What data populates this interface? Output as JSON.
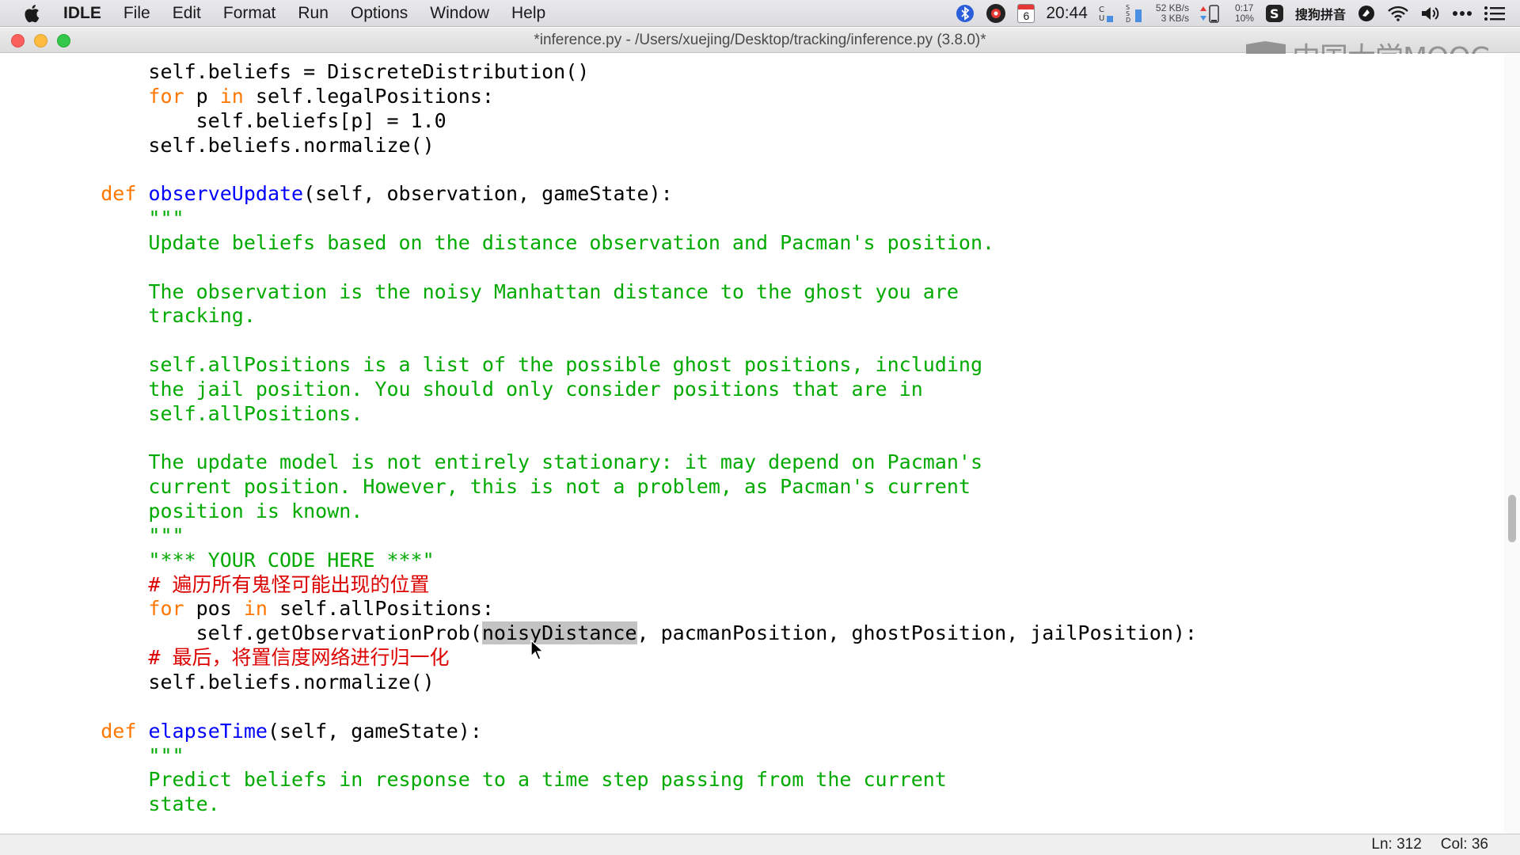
{
  "menubar": {
    "apple_icon": "apple-logo-icon",
    "app_name": "IDLE",
    "items": [
      "File",
      "Edit",
      "Format",
      "Run",
      "Options",
      "Window",
      "Help"
    ],
    "status": {
      "bluetooth_icon": "bluetooth-icon",
      "calendar_day": "6",
      "clock": "20:44",
      "cpu_label": "C\nU",
      "ssd_label": "S\nS\nD",
      "net_up": "52 KB/s",
      "net_down": "3 KB/s",
      "battery_time": "0:17",
      "battery_pct": "10%",
      "ime_label": "搜狗拼音",
      "wifi_icon": "wifi-icon",
      "volume_icon": "volume-icon",
      "more_icon": "more-icon",
      "list_icon": "control-center-icon"
    }
  },
  "window": {
    "title": "*inference.py - /Users/xuejing/Desktop/tracking/inference.py (3.8.0)*",
    "watermark_text": "中国大学MOOC",
    "statusbar": {
      "line": "Ln: 312",
      "col": "Col: 36"
    }
  },
  "code": {
    "lines": [
      {
        "indent": "        ",
        "parts": [
          [
            "",
            "self.beliefs = DiscreteDistribution()"
          ]
        ]
      },
      {
        "indent": "        ",
        "parts": [
          [
            "kw",
            "for"
          ],
          [
            "",
            " p "
          ],
          [
            "kw",
            "in"
          ],
          [
            "",
            " self.legalPositions:"
          ]
        ]
      },
      {
        "indent": "            ",
        "parts": [
          [
            "",
            "self.beliefs[p] = 1.0"
          ]
        ]
      },
      {
        "indent": "        ",
        "parts": [
          [
            "",
            "self.beliefs.normalize()"
          ]
        ]
      },
      {
        "indent": "",
        "parts": []
      },
      {
        "indent": "    ",
        "parts": [
          [
            "kw",
            "def"
          ],
          [
            "",
            " "
          ],
          [
            "fn",
            "observeUpdate"
          ],
          [
            "",
            "(self, observation, gameState):"
          ]
        ]
      },
      {
        "indent": "        ",
        "parts": [
          [
            "str",
            "\"\"\""
          ]
        ]
      },
      {
        "indent": "        ",
        "parts": [
          [
            "str",
            "Update beliefs based on the distance observation and Pacman's position."
          ]
        ]
      },
      {
        "indent": "",
        "parts": []
      },
      {
        "indent": "        ",
        "parts": [
          [
            "str",
            "The observation is the noisy Manhattan distance to the ghost you are"
          ]
        ]
      },
      {
        "indent": "        ",
        "parts": [
          [
            "str",
            "tracking."
          ]
        ]
      },
      {
        "indent": "",
        "parts": []
      },
      {
        "indent": "        ",
        "parts": [
          [
            "str",
            "self.allPositions is a list of the possible ghost positions, including"
          ]
        ]
      },
      {
        "indent": "        ",
        "parts": [
          [
            "str",
            "the jail position. You should only consider positions that are in"
          ]
        ]
      },
      {
        "indent": "        ",
        "parts": [
          [
            "str",
            "self.allPositions."
          ]
        ]
      },
      {
        "indent": "",
        "parts": []
      },
      {
        "indent": "        ",
        "parts": [
          [
            "str",
            "The update model is not entirely stationary: it may depend on Pacman's"
          ]
        ]
      },
      {
        "indent": "        ",
        "parts": [
          [
            "str",
            "current position. However, this is not a problem, as Pacman's current"
          ]
        ]
      },
      {
        "indent": "        ",
        "parts": [
          [
            "str",
            "position is known."
          ]
        ]
      },
      {
        "indent": "        ",
        "parts": [
          [
            "str",
            "\"\"\""
          ]
        ]
      },
      {
        "indent": "        ",
        "parts": [
          [
            "str",
            "\"*** YOUR CODE HERE ***\""
          ]
        ]
      },
      {
        "indent": "        ",
        "parts": [
          [
            "cmt",
            "# 遍历所有鬼怪可能出现的位置"
          ]
        ]
      },
      {
        "indent": "        ",
        "parts": [
          [
            "kw",
            "for"
          ],
          [
            "",
            " pos "
          ],
          [
            "kw",
            "in"
          ],
          [
            "",
            " self.allPositions:"
          ]
        ]
      },
      {
        "indent": "            ",
        "parts": [
          [
            "",
            "self.getObservationProb("
          ],
          [
            "sel",
            "noisyDistance"
          ],
          [
            "",
            ", pacmanPosition, ghostPosition, jailPosition):"
          ]
        ]
      },
      {
        "indent": "        ",
        "parts": [
          [
            "cmt",
            "# 最后，将置信度网络进行归一化"
          ]
        ]
      },
      {
        "indent": "        ",
        "parts": [
          [
            "",
            "self.beliefs.normalize()"
          ]
        ]
      },
      {
        "indent": "",
        "parts": []
      },
      {
        "indent": "    ",
        "parts": [
          [
            "kw",
            "def"
          ],
          [
            "",
            " "
          ],
          [
            "fn",
            "elapseTime"
          ],
          [
            "",
            "(self, gameState):"
          ]
        ]
      },
      {
        "indent": "        ",
        "parts": [
          [
            "str",
            "\"\"\""
          ]
        ]
      },
      {
        "indent": "        ",
        "parts": [
          [
            "str",
            "Predict beliefs in response to a time step passing from the current"
          ]
        ]
      },
      {
        "indent": "        ",
        "parts": [
          [
            "str",
            "state."
          ]
        ]
      }
    ]
  },
  "colors": {
    "keyword": "#ff7700",
    "function": "#0000ff",
    "string": "#00aa00",
    "comment": "#dd0000",
    "selection": "#c3c3c3"
  }
}
